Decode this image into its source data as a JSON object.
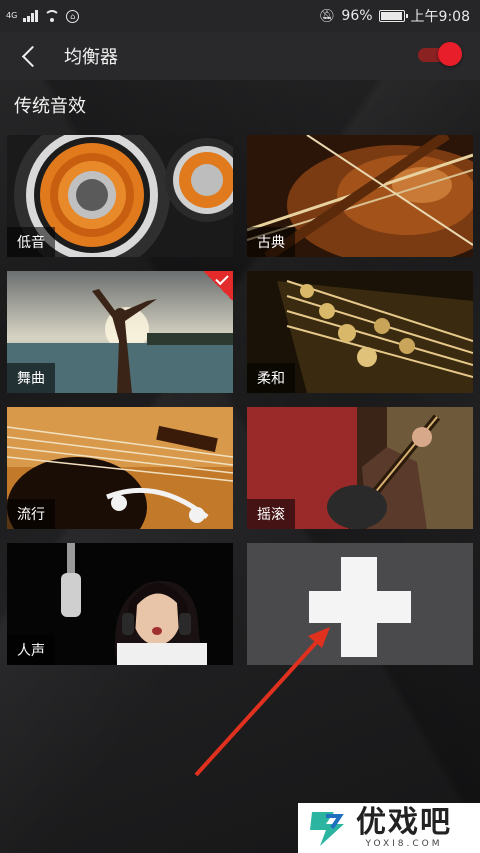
{
  "status_bar": {
    "network": "4G",
    "battery_percent": "96%",
    "battery_level": 0.96,
    "time": "上午9:08"
  },
  "app_bar": {
    "title": "均衡器",
    "toggle_on": true
  },
  "section_title": "传统音效",
  "presets": [
    {
      "label": "低音",
      "selected": false
    },
    {
      "label": "古典",
      "selected": false
    },
    {
      "label": "舞曲",
      "selected": true
    },
    {
      "label": "柔和",
      "selected": false
    },
    {
      "label": "流行",
      "selected": false
    },
    {
      "label": "摇滚",
      "selected": false
    },
    {
      "label": "人声",
      "selected": false
    }
  ],
  "watermark": {
    "main": "优戏吧",
    "sub": "YOXI8.COM"
  },
  "colors": {
    "accent": "#e81f2a",
    "background": "#1c1c1e",
    "appbar": "#29292b",
    "add_tile": "#4a4a4d",
    "annotation_arrow": "#e0301e"
  }
}
